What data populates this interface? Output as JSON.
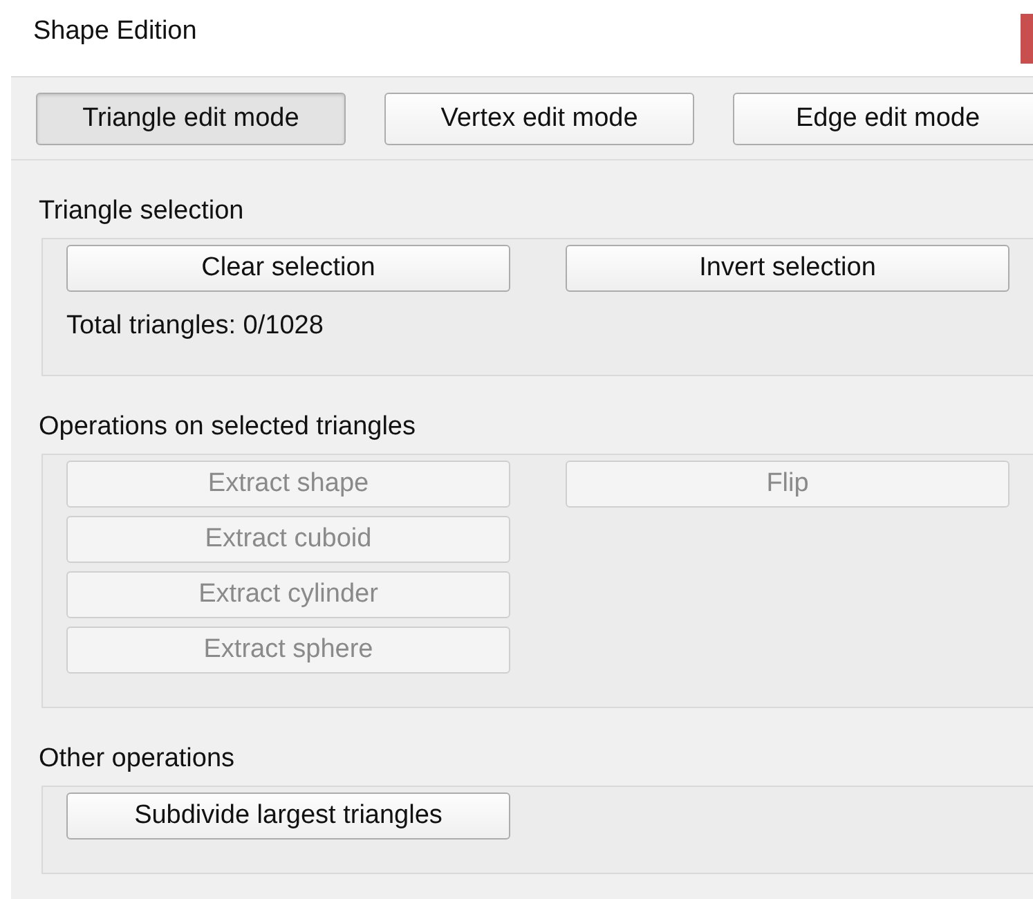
{
  "window": {
    "title": "Shape Edition"
  },
  "modes": [
    {
      "label": "Triangle edit mode",
      "selected": true
    },
    {
      "label": "Vertex edit mode",
      "selected": false
    },
    {
      "label": "Edge edit mode",
      "selected": false
    }
  ],
  "groups": [
    {
      "title": "Triangle selection",
      "columns": [
        [
          {
            "label": "Clear selection",
            "disabled": false
          }
        ],
        [
          {
            "label": "Invert selection",
            "disabled": false
          }
        ]
      ],
      "info": "Total triangles: 0/1028"
    },
    {
      "title": "Operations on selected triangles",
      "columns": [
        [
          {
            "label": "Extract shape",
            "disabled": true
          },
          {
            "label": "Extract cuboid",
            "disabled": true
          },
          {
            "label": "Extract cylinder",
            "disabled": true
          },
          {
            "label": "Extract sphere",
            "disabled": true
          }
        ],
        [
          {
            "label": "Flip",
            "disabled": true
          }
        ]
      ]
    },
    {
      "title": "Other operations",
      "columns": [
        [
          {
            "label": "Subdivide largest triangles",
            "disabled": false
          }
        ]
      ]
    }
  ]
}
